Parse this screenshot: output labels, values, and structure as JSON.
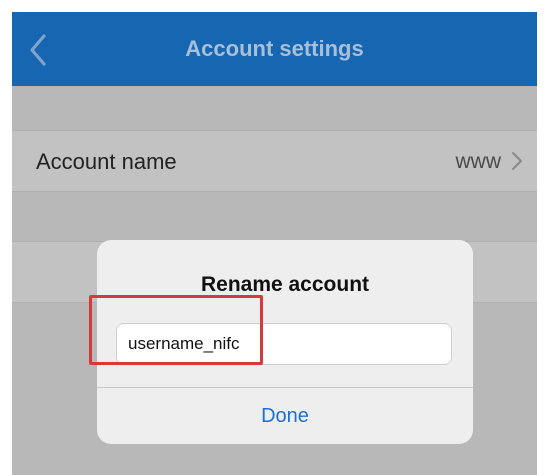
{
  "navbar": {
    "title": "Account settings",
    "back_icon": "chevron-left-icon",
    "color": "#1666b2"
  },
  "settings": {
    "account_row": {
      "label": "Account name",
      "value": "www",
      "chevron_icon": "chevron-right-icon"
    }
  },
  "dialog": {
    "title": "Rename account",
    "input_value": "username_nifc",
    "done_label": "Done",
    "highlight_color": "#d63a3a"
  }
}
